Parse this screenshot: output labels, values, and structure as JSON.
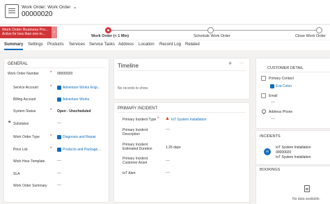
{
  "header": {
    "entity_label": "Work Order: Work Order",
    "record_title": "00000020"
  },
  "bpf": {
    "process_name": "Work Order Business Pro...",
    "process_status": "Active for less than one m...",
    "stages": [
      {
        "label": "Work Order (< 1 Min)"
      },
      {
        "label": "Schedule Work Order"
      },
      {
        "label": "Close Work Order"
      }
    ]
  },
  "tabs": [
    "Summary",
    "Settings",
    "Products",
    "Services",
    "Service Tasks",
    "Address",
    "Location",
    "Record Log",
    "Related"
  ],
  "general": {
    "title": "GENERAL",
    "fields": {
      "work_order_number": {
        "label": "Work Order Number",
        "value": "00000020"
      },
      "service_account": {
        "label": "Service Account",
        "value": "Adventure Works Engi..."
      },
      "billing_account": {
        "label": "Billing Account",
        "value": "Adventure Works"
      },
      "system_status": {
        "label": "System Status",
        "value": "Open - Unscheduled"
      },
      "substatus": {
        "label": "Substatus",
        "value": "---"
      },
      "work_order_type": {
        "label": "Work Order Type",
        "value": "Diagnosis and Repair"
      },
      "price_list": {
        "label": "Price List",
        "value": "Products and Package..."
      },
      "work_hour_template": {
        "label": "Work Hour Template",
        "value": "---"
      },
      "sla": {
        "label": "SLA",
        "value": "---"
      },
      "work_order_summary": {
        "label": "Work Order Summary",
        "value": "---"
      }
    }
  },
  "timeline": {
    "title": "Timeline",
    "empty_text": "No records to show.",
    "add_glyph": "+",
    "more_glyph": "···"
  },
  "primary_incident": {
    "title": "PRIMARY INCIDENT",
    "fields": {
      "type": {
        "label": "Primary Incident Type",
        "value": "IoT System Installation"
      },
      "description": {
        "label1": "Primary Incident",
        "label2": "Description",
        "value": "---"
      },
      "duration": {
        "label1": "Primary Incident",
        "label2": "Estimated Duration",
        "value": "1.25 days"
      },
      "customer_asset": {
        "label1": "Primary Incident",
        "label2": "Customer Asset",
        "value": "---"
      },
      "iot_alert": {
        "label": "IoT Alert",
        "value": "---"
      }
    }
  },
  "customer_detail": {
    "title": "CUSTOMER DETAIL",
    "primary_contact": {
      "label": "Primary Contact",
      "value": "Eva Colon"
    },
    "email": {
      "label": "Email",
      "value": "---"
    },
    "address_phone": {
      "label": "Address Phone",
      "value": "---"
    }
  },
  "incidents": {
    "title": "INCIDENTS",
    "item": {
      "initials": "IS",
      "line1": "IoT System Installation",
      "line2": "00000020",
      "line3": "IoT System Installation"
    }
  },
  "bookings": {
    "title": "BOOKINGS",
    "empty_text": "No data available."
  },
  "colors": {
    "accent": "#0f6cbd",
    "process_flag": "#d13438",
    "required": "#a4262c"
  }
}
